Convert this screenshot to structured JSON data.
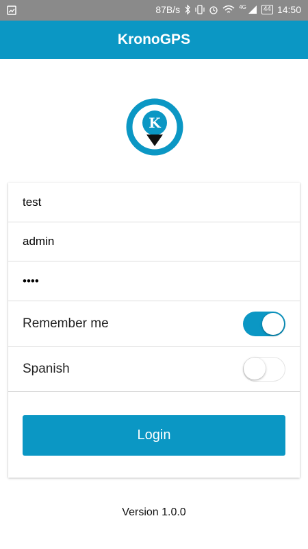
{
  "status_bar": {
    "network_speed": "87B/s",
    "network_type": "4G",
    "battery": "44",
    "time": "14:50"
  },
  "app_bar": {
    "title": "KronoGPS"
  },
  "logo": {
    "letter": "K"
  },
  "form": {
    "field1_value": "test",
    "field2_value": "admin",
    "password_value": "••••",
    "remember_label": "Remember me",
    "remember_on": true,
    "spanish_label": "Spanish",
    "spanish_on": false,
    "login_label": "Login"
  },
  "footer": {
    "version": "Version 1.0.0"
  },
  "colors": {
    "primary": "#0b97c4",
    "status_bar": "#8a8a8a"
  }
}
